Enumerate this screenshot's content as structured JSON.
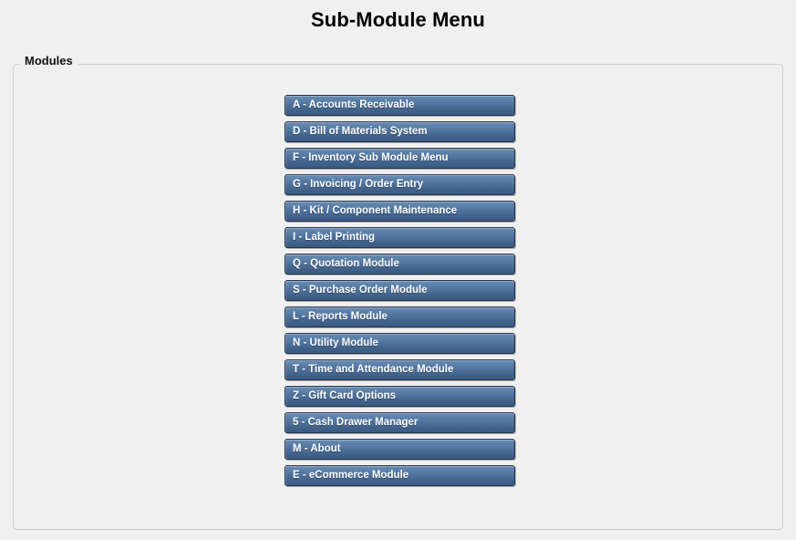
{
  "window": {
    "title": "Sub-Module Menu"
  },
  "group": {
    "legend": "Modules"
  },
  "colors": {
    "page_background": "#f0f0f0",
    "button_gradient_top": "#6a8cb4",
    "button_gradient_bottom": "#3a5a81",
    "button_border": "#27354a",
    "button_text": "#ffffff",
    "group_border": "#c9cfd6",
    "title_text": "#000000"
  },
  "modules": {
    "buttons": [
      {
        "key": "A",
        "label": "A - Accounts Receivable"
      },
      {
        "key": "D",
        "label": "D - Bill of Materials System"
      },
      {
        "key": "F",
        "label": "F - Inventory Sub Module Menu"
      },
      {
        "key": "G",
        "label": "G - Invoicing / Order Entry"
      },
      {
        "key": "H",
        "label": "H - Kit / Component Maintenance"
      },
      {
        "key": "I",
        "label": "I - Label Printing"
      },
      {
        "key": "Q",
        "label": "Q - Quotation Module"
      },
      {
        "key": "S",
        "label": "S - Purchase Order Module"
      },
      {
        "key": "L",
        "label": "L - Reports Module"
      },
      {
        "key": "N",
        "label": "N - Utility Module"
      },
      {
        "key": "T",
        "label": "T - Time and Attendance Module"
      },
      {
        "key": "Z",
        "label": "Z - Gift Card Options"
      },
      {
        "key": "5",
        "label": "5 - Cash Drawer Manager"
      },
      {
        "key": "M",
        "label": "M - About"
      },
      {
        "key": "E",
        "label": "E - eCommerce Module"
      }
    ]
  }
}
